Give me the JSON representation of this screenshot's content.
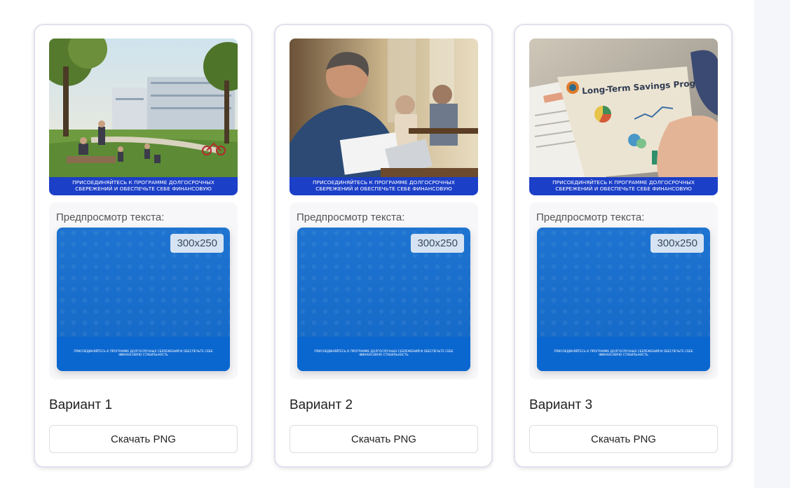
{
  "variants": [
    {
      "title": "Вариант 1",
      "thumb_caption": "ПРИСОЕДИНЯЙТЕСЬ К ПРОГРАММЕ ДОЛГОСРОЧНЫХ\nСБЕРЕЖЕНИЙ И ОБЕСПЕЧЬТЕ СЕБЕ ФИНАНСОВУЮ",
      "preview_label": "Предпросмотр текста:",
      "size": "300x250",
      "banner_text": "ПРИСОЕДИНЯЙТЕСЬ К ПРОГРАММЕ ДОЛГОСРОЧНЫХ СБЕРЕЖЕНИЙ И ОБЕСПЕЧЬТЕ СЕБЕ ФИНАНСОВУЮ СТАБИЛЬНОСТЬ",
      "download_label": "Скачать PNG",
      "image": "park-family-scene"
    },
    {
      "title": "Вариант 2",
      "thumb_caption": "ПРИСОЕДИНЯЙТЕСЬ К ПРОГРАММЕ ДОЛГОСРОЧНЫХ\nСБЕРЕЖЕНИЙ И ОБЕСПЕЧЬТЕ СЕБЕ ФИНАНСОВУЮ",
      "preview_label": "Предпросмотр текста:",
      "size": "300x250",
      "banner_text": "ПРИСОЕДИНЯЙТЕСЬ К ПРОГРАММЕ ДОЛГОСРОЧНЫХ СБЕРЕЖЕНИЙ И ОБЕСПЕЧЬТЕ СЕБЕ ФИНАНСОВУЮ СТАБИЛЬНОСТЬ",
      "download_label": "Скачать PNG",
      "image": "man-reading-documents-cafe"
    },
    {
      "title": "Вариант 3",
      "thumb_caption": "ПРИСОЕДИНЯЙТЕСЬ К ПРОГРАММЕ ДОЛГОСРОЧНЫХ\nСБЕРЕЖЕНИЙ И ОБЕСПЕЧЬТЕ СЕБЕ ФИНАНСОВУЮ",
      "preview_label": "Предпросмотр текста:",
      "size": "300x250",
      "banner_text": "ПРИСОЕДИНЯЙТЕСЬ К ПРОГРАММЕ ДОЛГОСРОЧНЫХ СБЕРЕЖЕНИЙ И ОБЕСПЕЧЬТЕ СЕБЕ ФИНАНСОВУЮ СТАБИЛЬНОСТЬ",
      "download_label": "Скачать PNG",
      "image": "savings-brochure",
      "brochure_title": "Long-Term Savings Program"
    }
  ],
  "colors": {
    "strip": "#1c3fc8",
    "banner": "#1565c0",
    "card_border": "#e2e0ee"
  }
}
